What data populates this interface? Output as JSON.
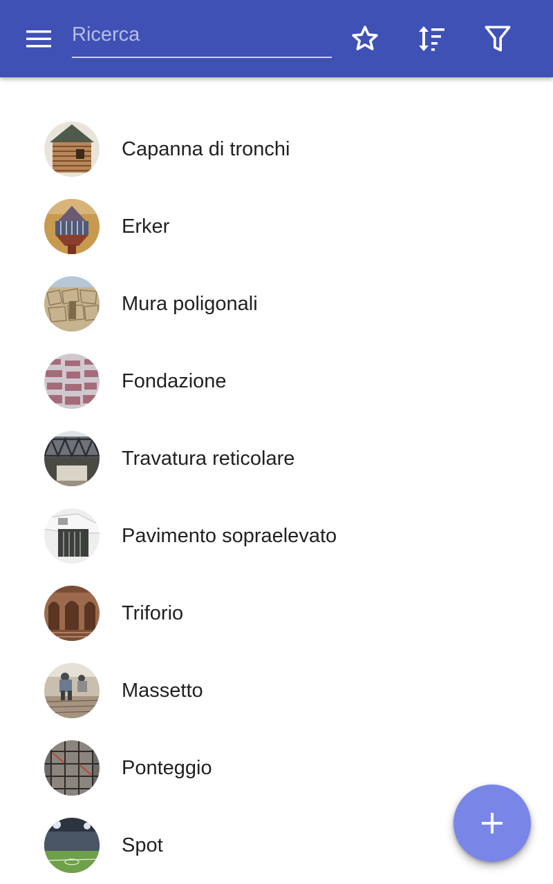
{
  "header": {
    "background": "#3f51b5",
    "menu_icon": "menu-icon",
    "search": {
      "placeholder": "Ricerca",
      "value": ""
    },
    "actions": [
      {
        "icon": "star-icon"
      },
      {
        "icon": "sort-icon"
      },
      {
        "icon": "filter-icon"
      }
    ]
  },
  "list": {
    "items": [
      {
        "label": "Capanna di tronchi"
      },
      {
        "label": "Erker"
      },
      {
        "label": "Mura poligonali"
      },
      {
        "label": "Fondazione"
      },
      {
        "label": "Travatura reticolare"
      },
      {
        "label": "Pavimento sopraelevato"
      },
      {
        "label": "Triforio"
      },
      {
        "label": "Massetto"
      },
      {
        "label": "Ponteggio"
      },
      {
        "label": "Spot"
      }
    ]
  },
  "fab": {
    "icon": "add-icon",
    "color": "#7986e8"
  }
}
